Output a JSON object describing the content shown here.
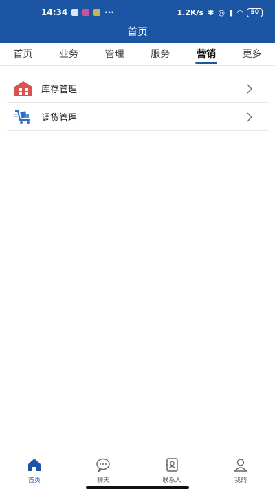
{
  "status_bar": {
    "time": "14:34",
    "dots": "···",
    "speed": "1.2K/s",
    "battery": "50"
  },
  "header": {
    "title": "首页"
  },
  "tabs": [
    {
      "label": "首页"
    },
    {
      "label": "业务"
    },
    {
      "label": "管理"
    },
    {
      "label": "服务"
    },
    {
      "label": "营销"
    },
    {
      "label": "更多"
    }
  ],
  "active_tab": "营销",
  "menu": [
    {
      "label": "库存管理",
      "icon": "warehouse-icon"
    },
    {
      "label": "调货管理",
      "icon": "cart-icon"
    }
  ],
  "bottom_nav": [
    {
      "label": "首页",
      "icon": "home-icon"
    },
    {
      "label": "聊天",
      "icon": "chat-icon"
    },
    {
      "label": "联系人",
      "icon": "contacts-icon"
    },
    {
      "label": "我的",
      "icon": "user-icon"
    }
  ],
  "colors": {
    "primary": "#1c55a3",
    "warehouse": "#d9534f",
    "cart": "#2f6fc3"
  }
}
